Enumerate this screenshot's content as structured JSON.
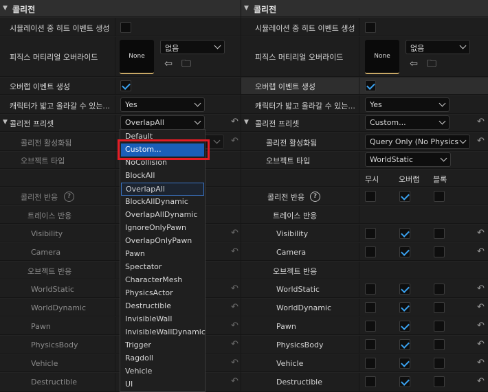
{
  "left": {
    "section_title": "콜리전",
    "rows": {
      "sim_hit_label": "시뮬레이션 중 히트 이벤트 생성",
      "phys_mat_label": "피직스 머티리얼 오버라이드",
      "phys_mat_swatch": "None",
      "phys_mat_combo": "없음",
      "overlap_label": "오버랩 이벤트 생성",
      "can_step_label": "캐릭터가 밟고 올라갈 수 있는...",
      "can_step_value": "Yes",
      "preset_label": "콜리전 프리셋",
      "preset_value": "OverlapAll",
      "collision_enabled_label": "콜리전 활성화됨",
      "object_type_label": "오브젝트 타입",
      "responses_label": "콜리전 반응",
      "trace_label": "트레이스 반응",
      "object_resp_label": "오브젝트 반응",
      "trace_items": [
        "Visibility",
        "Camera"
      ],
      "object_items": [
        "WorldStatic",
        "WorldDynamic",
        "Pawn",
        "PhysicsBody",
        "Vehicle",
        "Destructible"
      ]
    }
  },
  "right": {
    "section_title": "콜리전",
    "rows": {
      "sim_hit_label": "시뮬레이션 중 히트 이벤트 생성",
      "phys_mat_label": "피직스 머티리얼 오버라이드",
      "phys_mat_swatch": "None",
      "phys_mat_combo": "없음",
      "overlap_label": "오버랩 이벤트 생성",
      "can_step_label": "캐릭터가 밟고 올라갈 수 있는...",
      "can_step_value": "Yes",
      "preset_label": "콜리전 프리셋",
      "preset_value": "Custom...",
      "collision_enabled_label": "콜리전 활성화됨",
      "collision_enabled_value": "Query Only (No Physics",
      "object_type_label": "오브젝트 타입",
      "object_type_value": "WorldStatic",
      "col_ignore": "무시",
      "col_overlap": "오버랩",
      "col_block": "블록",
      "responses_label": "콜리전 반응",
      "trace_label": "트레이스 반응",
      "object_resp_label": "오브젝트 반응",
      "trace_items": [
        "Visibility",
        "Camera"
      ],
      "object_items": [
        "WorldStatic",
        "WorldDynamic",
        "Pawn",
        "PhysicsBody",
        "Vehicle",
        "Destructible"
      ]
    }
  },
  "dropdown": {
    "options": [
      "Default",
      "Custom...",
      "NoCollision",
      "BlockAll",
      "OverlapAll",
      "BlockAllDynamic",
      "OverlapAllDynamic",
      "IgnoreOnlyPawn",
      "OverlapOnlyPawn",
      "Pawn",
      "Spectator",
      "CharacterMesh",
      "PhysicsActor",
      "Destructible",
      "InvisibleWall",
      "InvisibleWallDynamic",
      "Trigger",
      "Ragdoll",
      "Vehicle",
      "UI"
    ],
    "hovered": "Custom...",
    "selected": "OverlapAll"
  },
  "colors": {
    "accent_blue": "#3aa2f0",
    "hover_blue": "#1a5fb8",
    "highlight_red": "#e41c25",
    "swatch_gold": "#c8a866"
  }
}
